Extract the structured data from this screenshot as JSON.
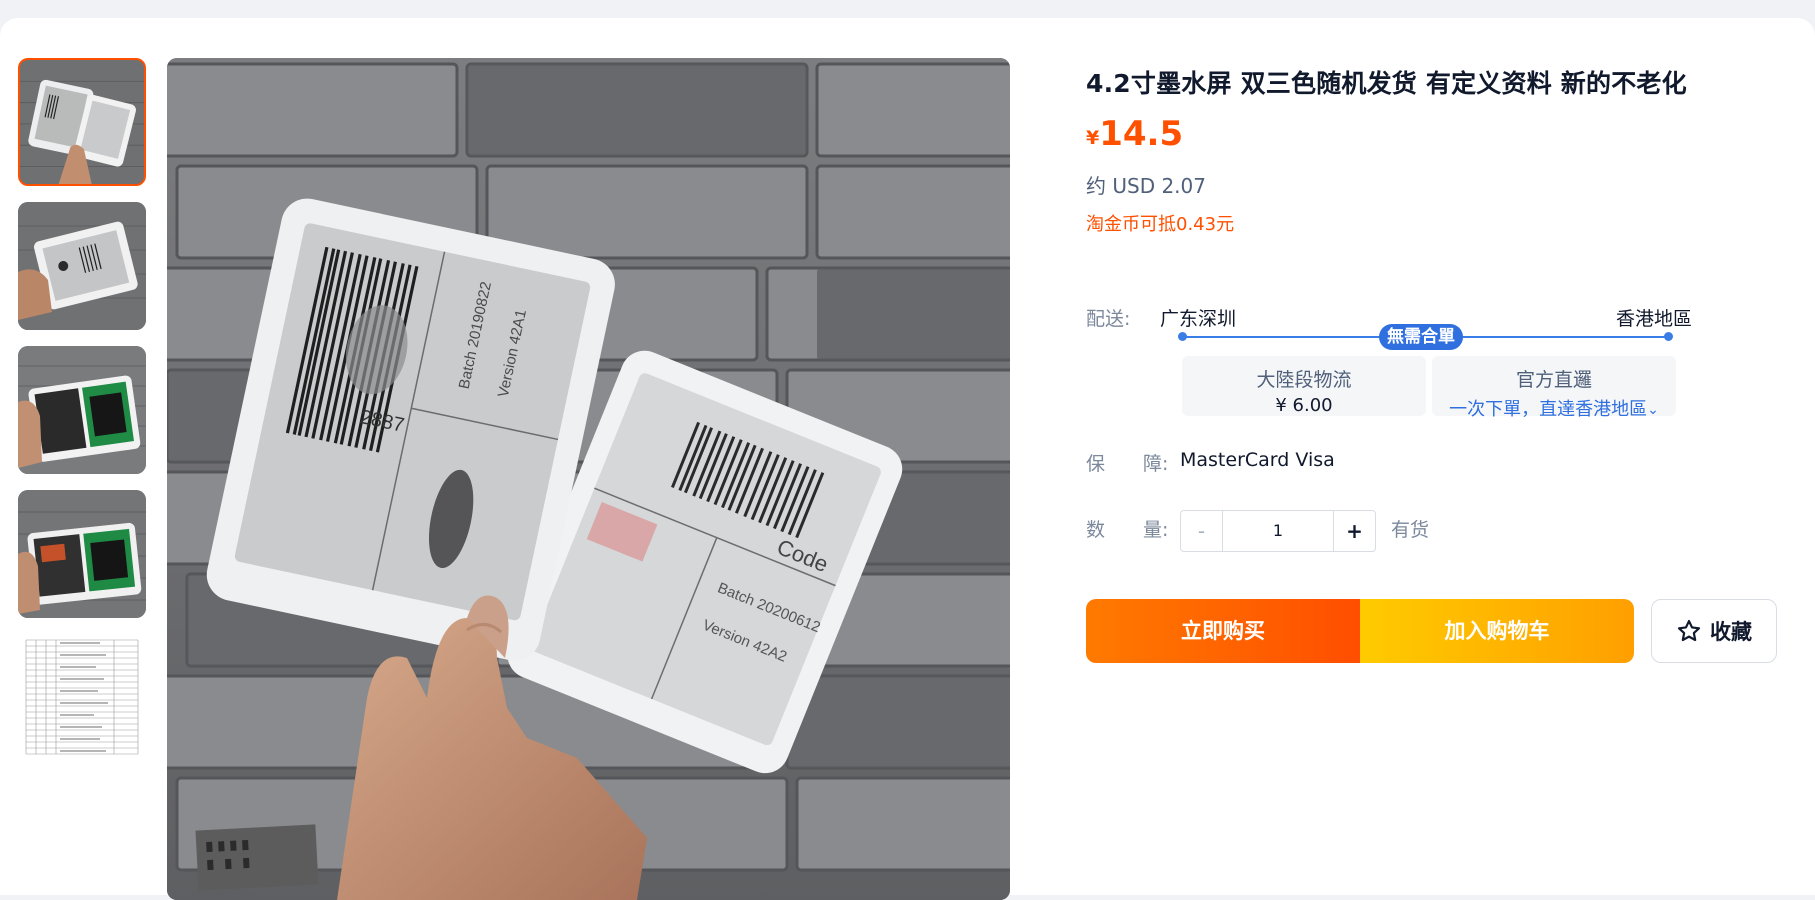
{
  "product": {
    "title": "4.2寸墨水屏 双三色随机发货 有定义资料 新的不老化",
    "price_symbol": "¥",
    "price": "14.5",
    "usd": "约 USD 2.07",
    "coin_discount": "淘金币可抵0.43元"
  },
  "shipping": {
    "label": "配送:",
    "from": "广东深圳",
    "to": "香港地區",
    "badge": "無需合單",
    "option_mainland": {
      "title": "大陸段物流",
      "price": "¥ 6.00"
    },
    "option_direct": {
      "title": "官方直邏",
      "link": "一次下單，直達香港地區",
      "chevron": "⌄"
    }
  },
  "guarantee": {
    "label": "保　　障:",
    "value": "MasterCard Visa"
  },
  "quantity": {
    "label": "数　　量:",
    "minus": "-",
    "value": "1",
    "plus": "+",
    "stock": "有货"
  },
  "actions": {
    "buy_now": "立即购买",
    "add_to_cart": "加入购物车",
    "favorite": "收藏"
  },
  "colors": {
    "accent": "#ff5000",
    "link": "#2f6fdf",
    "buy_gradient": [
      "#ff7a00",
      "#ff4e00"
    ],
    "cart_gradient": [
      "#ffcb00",
      "#ff9f00"
    ]
  },
  "gallery": {
    "thumbnails": [
      "product-photo-1",
      "product-photo-2",
      "product-photo-3",
      "product-photo-4",
      "spec-sheet"
    ],
    "selected": 0
  },
  "main_photo": {
    "label_a": {
      "batch": "Batch 20190822",
      "version": "Version 42A1",
      "code": "2887"
    },
    "label_b": {
      "batch": "Batch 20200612",
      "version": "Version 42A2",
      "code": "Code"
    }
  }
}
